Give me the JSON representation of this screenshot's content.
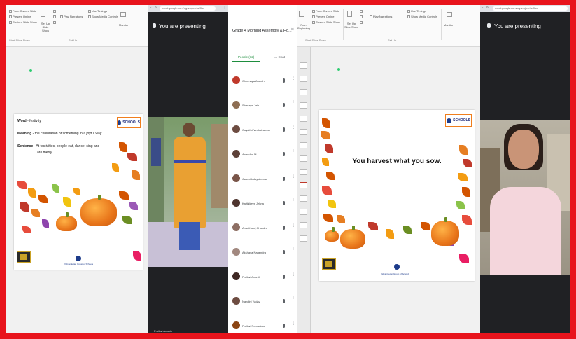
{
  "ppt_left": {
    "ribbon": {
      "from_current_slide": "From Current Slide",
      "present_online": "Present Online",
      "custom_slide_show": "Custom Slide Show",
      "start_slide_show": "Start Slide Show",
      "set_up_slide_show": "Set Up Slide Show",
      "hide_slide": "Hide Slide",
      "rehearse_timings": "Rehearse Timings",
      "record": "Record",
      "play_narrations": "Play Narrations",
      "use_timings": "Use Timings",
      "show_media_controls": "Show Media Controls",
      "monitor": "Monitor",
      "set_up": "Set Up"
    },
    "slide": {
      "word_label": "Word",
      "word_value": " - festivity",
      "meaning_label": "Meaning",
      "meaning_value": " - the celebration of something in a joyful way",
      "sentence_label": "Sentence",
      "sentence_value": " - At festivities, people eat, dance, sing and",
      "sentence_cont": "are merry",
      "logo": "SCHOOLS",
      "footer": "Vidyaniketan Group of Schools"
    }
  },
  "meet_left": {
    "url": "meet.google.com/ng-zmjn-ehv/flux",
    "presenting": "You are presenting",
    "participant_name": "Pruthvi Ananth"
  },
  "people_panel": {
    "title": "Grade 4 Morning Assembly & Ho...",
    "tab_people": "People (12)",
    "tab_chat": "Chat",
    "participants": [
      {
        "name": "Chinmaya Ananth",
        "color": "#c0392b"
      },
      {
        "name": "Shanaya Jain",
        "color": "#8e6e53"
      },
      {
        "name": "Gayathri Venkatraman",
        "color": "#6d4c41"
      },
      {
        "name": "Anirudha M",
        "color": "#5d4037"
      },
      {
        "name": "Janani Udayakumar",
        "color": "#795548"
      },
      {
        "name": "Karthikeya Jehna",
        "color": "#4e342e"
      },
      {
        "name": "Anantharaj Chandra",
        "color": "#8d6e63"
      },
      {
        "name": "Akshaya Nagendra",
        "color": "#a1887f"
      },
      {
        "name": "Pruthvi Ananth",
        "color": "#3e2723"
      },
      {
        "name": "Nandini Yadav",
        "color": "#6d4c41"
      },
      {
        "name": "Pruthvi Ramadass",
        "color": "#8b4513"
      }
    ]
  },
  "ppt_right": {
    "slide": {
      "quote": "You harvest what you sow.",
      "logo": "SCHOOLS",
      "footer": "Vidyaniketan Group of Schools"
    },
    "ribbon": {
      "from_beginning": "From Beginning",
      "from_current_slide": "From Current Slide",
      "present_online": "Present Online",
      "custom_slide_show": "Custom Slide Show",
      "start_slide_show": "Start Slide Show",
      "set_up_slide_show": "Set Up Slide Show",
      "hide_slide": "Hide Slide",
      "rehearse_timings": "Rehearse Timings",
      "record": "Record",
      "play_narrations": "Play Narrations",
      "use_timings": "Use Timings",
      "show_media_controls": "Show Media Controls",
      "monitor": "Monitor",
      "set_up": "Set Up"
    }
  },
  "meet_right": {
    "url": "meet.google.com/ng-zmjn-ehv/flux",
    "presenting": "You are presenting"
  },
  "colors": {
    "frame_red": "#e8141c",
    "meet_dark": "#202124",
    "pumpkin_orange": "#e8751a",
    "logo_navy": "#1d2a7a"
  }
}
